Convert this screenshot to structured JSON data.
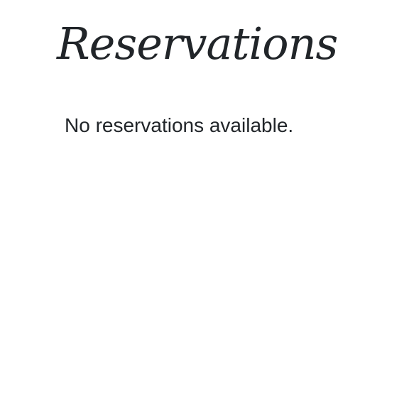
{
  "page": {
    "title": "Reservations",
    "empty_message": "No reservations available."
  },
  "colors": {
    "background": "#ffffff",
    "text": "#212529"
  }
}
